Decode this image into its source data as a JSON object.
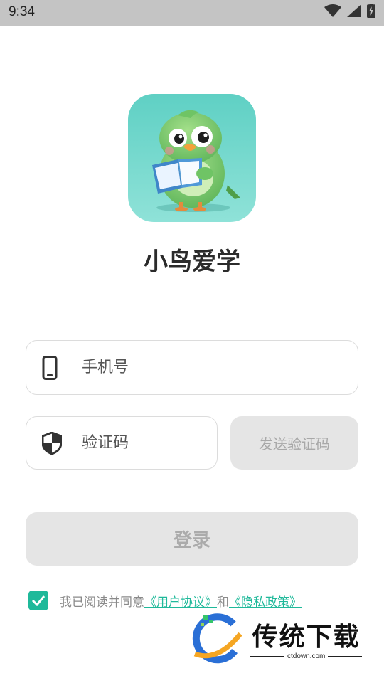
{
  "status_bar": {
    "time": "9:34",
    "icons": [
      "wifi-icon",
      "cellular-signal-icon",
      "battery-charging-icon"
    ]
  },
  "app": {
    "icon": "parrot-reading-book-icon",
    "name": "小鸟爱学"
  },
  "form": {
    "phone_placeholder": "手机号",
    "phone_icon": "phone-icon",
    "code_placeholder": "验证码",
    "code_icon": "shield-icon",
    "send_code_label": "发送验证码",
    "login_label": "登录"
  },
  "agreement": {
    "checked": true,
    "prefix": "我已阅读并同意",
    "user_agreement": "《用户协议》",
    "conjunction": "和",
    "privacy_policy": "《隐私政策》"
  },
  "watermark": {
    "title": "传统下载",
    "subtitle": "ctdown.com"
  },
  "colors": {
    "accent": "#1fb99a",
    "status_bar_bg": "#c4c4c4",
    "disabled_button_bg": "#e5e5e5",
    "icon_bg": "#6fd3c6"
  }
}
